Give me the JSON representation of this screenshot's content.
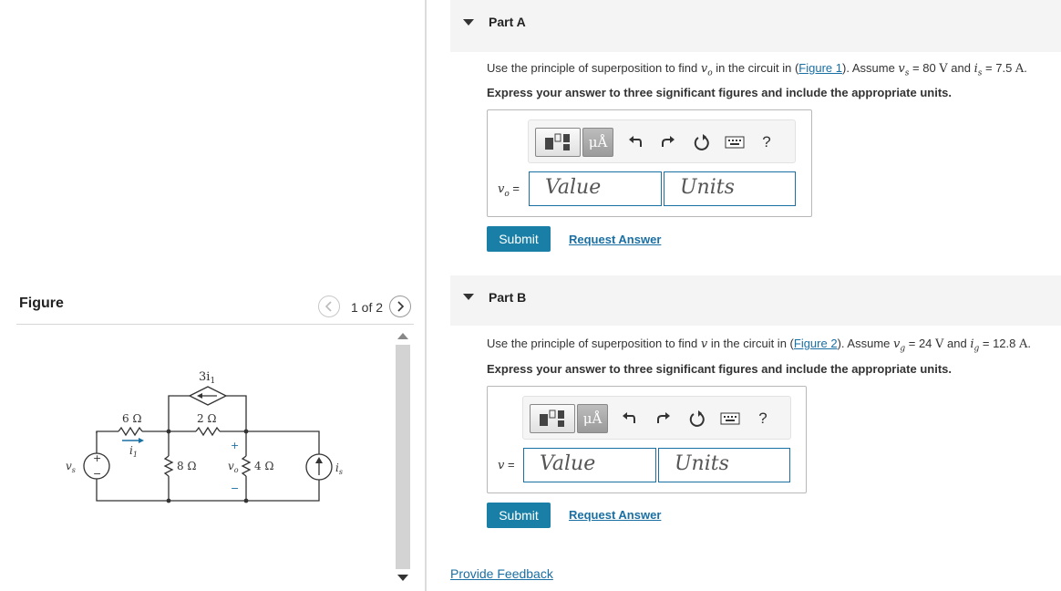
{
  "figure_panel": {
    "title": "Figure",
    "counter": "1 of 2",
    "circuit": {
      "labels": {
        "dep_source": "3i",
        "dep_source_sub": "1",
        "r_6": "6 Ω",
        "r_2": "2 Ω",
        "r_8": "8 Ω",
        "r_4": "4 Ω",
        "current_i1": "i",
        "current_i1_sub": "1",
        "vs": "v",
        "vs_sub": "s",
        "vo": "v",
        "vo_sub": "o",
        "is": "i",
        "is_sub": "s",
        "plus": "+",
        "minus": "−"
      },
      "colors": {
        "wire": "#333333",
        "arrow": "#1a6fa3"
      }
    }
  },
  "part_a": {
    "title": "Part A",
    "question": {
      "pre": "Use the principle of superposition to find ",
      "var": "v",
      "var_sub": "o",
      "mid": " in the circuit in (",
      "link": "Figure 1",
      "after_link": "). Assume ",
      "v1": "v",
      "v1_sub": "s",
      "eq1": " = 80 ",
      "unit1": "V",
      "and": " and ",
      "v2": "i",
      "v2_sub": "s",
      "eq2": " = 7.5 ",
      "unit2": "A",
      "end": "."
    },
    "instruction": "Express your answer to three significant figures and include the appropriate units.",
    "answer_label_var": "v",
    "answer_label_sub": "o",
    "answer_label_eq": " =",
    "value_placeholder": "Value",
    "units_placeholder": "Units",
    "submit": "Submit",
    "request": "Request Answer"
  },
  "part_b": {
    "title": "Part B",
    "question": {
      "pre": "Use the principle of superposition to find ",
      "var": "v",
      "mid": " in the circuit in (",
      "link": "Figure 2",
      "after_link": "). Assume ",
      "v1": "v",
      "v1_sub": "g",
      "eq1": " = 24 ",
      "unit1": "V",
      "and": " and ",
      "v2": "i",
      "v2_sub": "g",
      "eq2": " = 12.8 ",
      "unit2": "A",
      "end": "."
    },
    "instruction": "Express your answer to three significant figures and include the appropriate units.",
    "answer_label_var": "v",
    "answer_label_eq": " =",
    "value_placeholder": "Value",
    "units_placeholder": "Units",
    "submit": "Submit",
    "request": "Request Answer"
  },
  "toolbar": {
    "mu_label": "μÅ",
    "help": "?"
  },
  "feedback": "Provide Feedback",
  "colors": {
    "accent": "#1a7fa6",
    "link": "#1a6fa3",
    "header_bg": "#f4f4f4"
  }
}
